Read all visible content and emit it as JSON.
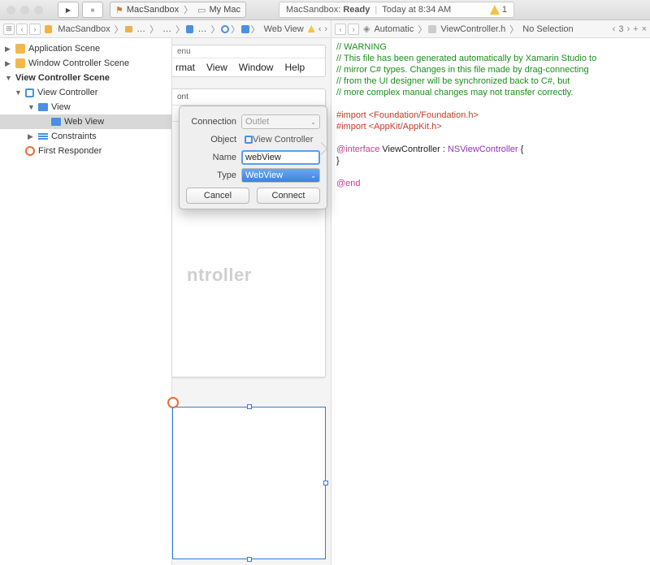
{
  "titlebar": {
    "scheme_target": "MacSandbox",
    "scheme_device": "My Mac",
    "status_project": "MacSandbox:",
    "status_state": "Ready",
    "status_time": "Today at 8:34 AM",
    "warn_count": "1"
  },
  "jumpbar_left": {
    "seg1": "MacSandbox",
    "seg2": "…",
    "seg3": "…",
    "seg4": "…",
    "seg5": "Web View"
  },
  "jumpbar_right": {
    "mode": "Automatic",
    "file": "ViewController.h",
    "sel": "No Selection",
    "counter": "3"
  },
  "navigator": {
    "app_scene": "Application Scene",
    "win_scene": "Window Controller Scene",
    "vc_scene": "View Controller Scene",
    "vc": "View Controller",
    "view": "View",
    "webview": "Web View",
    "constraints": "Constraints",
    "first_responder": "First Responder"
  },
  "canvas": {
    "menu_stub": "enu",
    "menu_items": {
      "format": "rmat",
      "view": "View",
      "window": "Window",
      "help": "Help"
    },
    "tab_stub": "ont",
    "placeholder": "ntroller"
  },
  "popover": {
    "lbl_connection": "Connection",
    "val_connection": "Outlet",
    "lbl_object": "Object",
    "val_object": "View Controller",
    "lbl_name": "Name",
    "val_name": "webView",
    "lbl_type": "Type",
    "val_type": "WebView",
    "btn_cancel": "Cancel",
    "btn_connect": "Connect"
  },
  "code": {
    "l1": "// WARNING",
    "l2": "// This file has been generated automatically by Xamarin Studio to",
    "l3": "// mirror C# types. Changes in this file made by drag-connecting",
    "l4": "// from the UI designer will be synchronized back to C#, but",
    "l5": "// more complex manual changes may not transfer correctly.",
    "imp": "#import ",
    "imp1": "<Foundation/Foundation.h>",
    "imp2": "<AppKit/AppKit.h>",
    "iface_kw": "@interface",
    "iface_name": " ViewController ",
    "iface_colon": ": ",
    "iface_super": "NSViewController ",
    "iface_brace": "{",
    "close_brace": "}",
    "end": "@end"
  }
}
